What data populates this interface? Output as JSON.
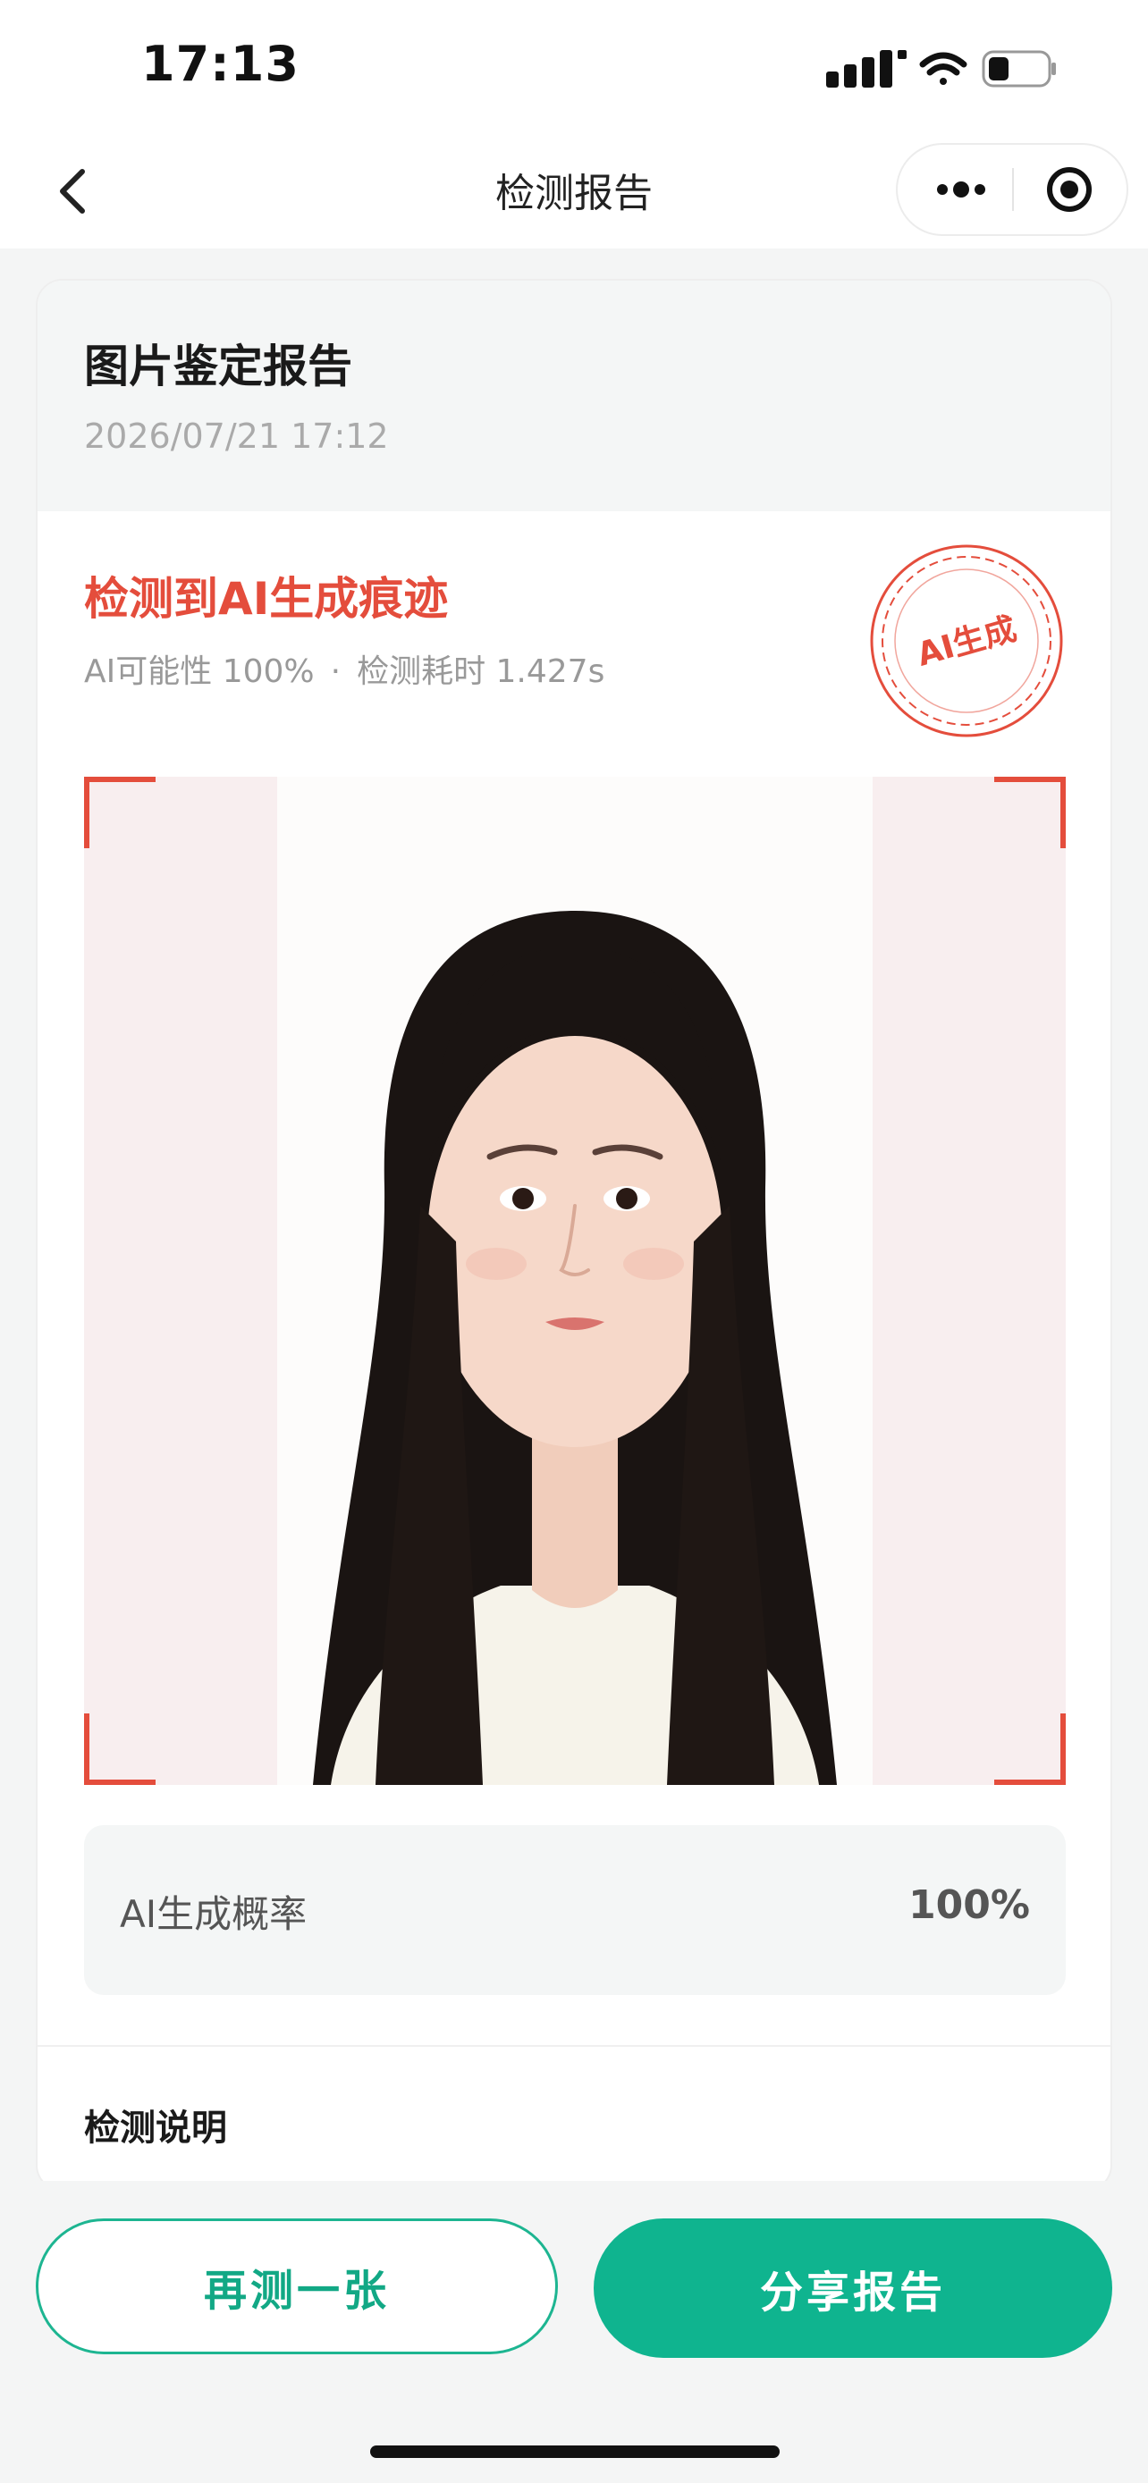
{
  "status_bar": {
    "time": "17:13"
  },
  "nav": {
    "title": "检测报告"
  },
  "report": {
    "title": "图片鉴定报告",
    "date": "2026/07/21 17:12"
  },
  "result": {
    "title": "检测到AI生成痕迹",
    "probability_text": "AI可能性 100%",
    "separator": "·",
    "duration_text": "检测耗时 1.427s",
    "stamp_text": "AI生成"
  },
  "probability": {
    "label": "AI生成概率",
    "value": "100%"
  },
  "section": {
    "title": "检测说明"
  },
  "actions": {
    "retry_label": "再测一张",
    "share_label": "分享报告"
  },
  "colors": {
    "accent_red": "#e44d3c",
    "brand_green": "#0fb48f",
    "background": "#f4f5f5"
  },
  "icons": [
    "back-icon",
    "more-icon",
    "target-icon",
    "signal-icon",
    "wifi-icon",
    "battery-icon"
  ]
}
